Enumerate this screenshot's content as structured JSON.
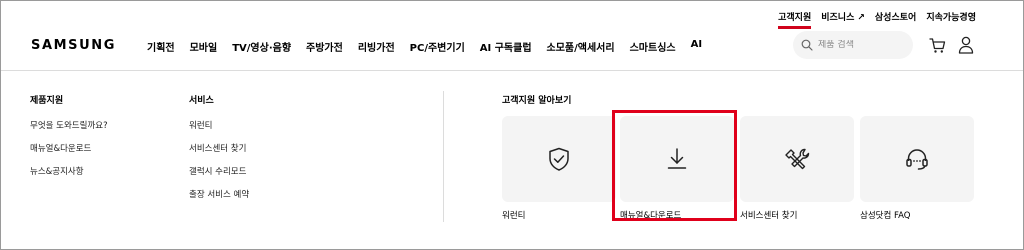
{
  "utility_nav": {
    "items": [
      {
        "label": "고객지원",
        "active": true
      },
      {
        "label": "비즈니스",
        "external": true
      },
      {
        "label": "삼성스토어"
      },
      {
        "label": "지속가능경영"
      }
    ],
    "external_arrow": "↗"
  },
  "header": {
    "logo": "SAMSUNG",
    "gnb": [
      "기획전",
      "모바일",
      "TV/영상·음향",
      "주방가전",
      "리빙가전",
      "PC/주변기기",
      "AI 구독클럽",
      "소모품/액세서리",
      "스마트싱스",
      "AI"
    ],
    "search": {
      "placeholder": "제품 검색"
    }
  },
  "menu": {
    "product_support": {
      "title": "제품지원",
      "links": [
        "무엇을 도와드릴까요?",
        "매뉴얼&다운로드",
        "뉴스&공지사항"
      ]
    },
    "service": {
      "title": "서비스",
      "links": [
        "워런티",
        "서비스센터 찾기",
        "갤럭시 수리모드",
        "출장 서비스 예약"
      ]
    }
  },
  "support_cards": {
    "title": "고객지원 알아보기",
    "cards": [
      {
        "label": "워런티",
        "icon": "shield-check-icon"
      },
      {
        "label": "매뉴얼&다운로드",
        "icon": "download-icon",
        "highlighted": true
      },
      {
        "label": "서비스센터 찾기",
        "icon": "tools-icon"
      },
      {
        "label": "삼성닷컴 FAQ",
        "icon": "headset-icon"
      }
    ]
  },
  "colors": {
    "accent_red": "#e0001b",
    "card_bg": "#f4f4f4",
    "divider": "#dcdcdc"
  }
}
